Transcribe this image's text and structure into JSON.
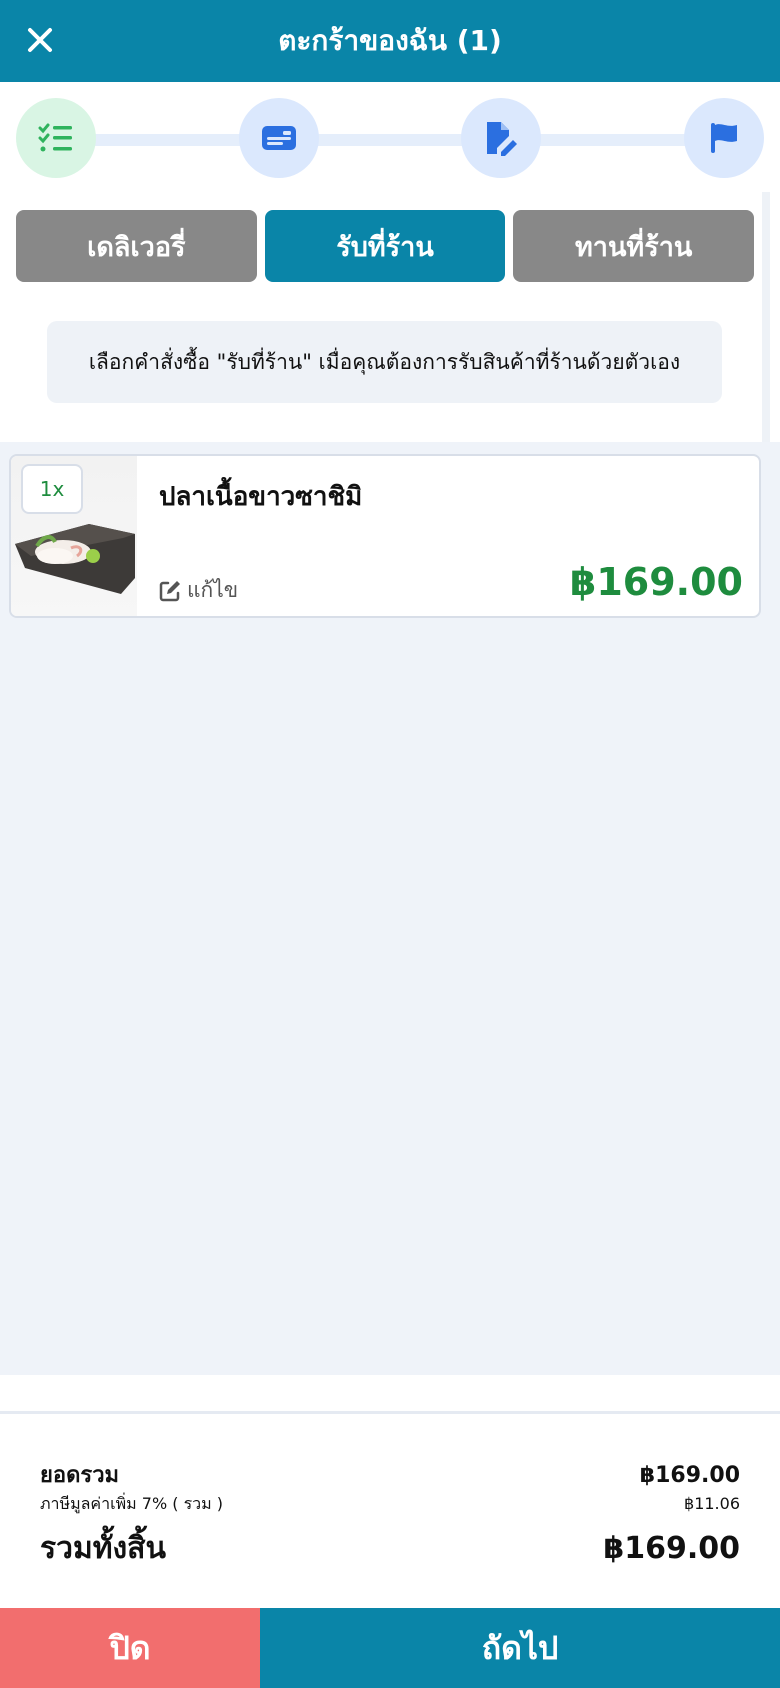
{
  "header": {
    "title": "ตะกร้าของฉัน (1)"
  },
  "steps": [
    {
      "icon": "list-check-icon",
      "state": "completed",
      "color": "#2fb35d"
    },
    {
      "icon": "id-card-icon",
      "state": "pending",
      "color": "#2b6fe0"
    },
    {
      "icon": "file-edit-icon",
      "state": "pending",
      "color": "#2b6fe0"
    },
    {
      "icon": "flag-icon",
      "state": "pending",
      "color": "#2b6fe0"
    }
  ],
  "order_types": {
    "tabs": [
      "เดลิเวอรี่",
      "รับที่ร้าน",
      "ทานที่ร้าน"
    ],
    "selected": "รับที่ร้าน",
    "note": "เลือกคำสั่งซื้อ \"รับที่ร้าน\" เมื่อคุณต้องการรับสินค้าที่ร้านด้วยตัวเอง"
  },
  "cart": {
    "items": [
      {
        "qty": "1x",
        "name": "ปลาเนื้อขาวซาชิมิ",
        "edit_label": "แก้ไข",
        "price": "฿169.00"
      }
    ]
  },
  "summary": {
    "subtotal_label": "ยอดรวม",
    "subtotal": "฿169.00",
    "vat_label": "ภาษีมูลค่าเพิ่ม 7% ( รวม )",
    "vat": "฿11.06",
    "total_label": "รวมทั้งสิ้น",
    "total": "฿169.00"
  },
  "footer": {
    "close_label": "ปิด",
    "next_label": "ถัดไป"
  },
  "colors": {
    "primary": "#0a85a8",
    "close": "#f26e6e",
    "price": "#1e8c3e",
    "inactive_tab": "#888888"
  }
}
